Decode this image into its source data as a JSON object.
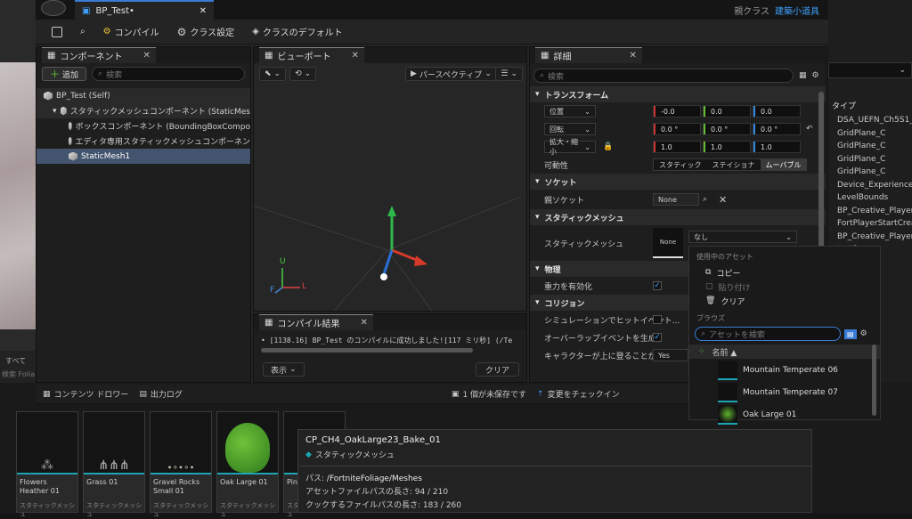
{
  "window": {
    "tab_title": "BP_Test•",
    "parent_label": "親クラス",
    "parent_value": "建築小道具"
  },
  "toolbar": {
    "compile": "コンパイル",
    "class_settings": "クラス設定",
    "class_defaults": "クラスのデフォルト"
  },
  "components": {
    "title": "コンポーネント",
    "add": "追加",
    "search_placeholder": "検索",
    "items": [
      "BP_Test (Self)",
      "スタティックメッシュコンポーネント (StaticMes",
      "ボックスコンポーネント (BoundingBoxCompo",
      "エディタ専用スタティックメッシュコンポーネン",
      "StaticMesh1"
    ]
  },
  "viewport": {
    "title": "ビューポート",
    "perspective": "パースペクティブ",
    "axis_x": "L",
    "axis_y": "F",
    "axis_z": "U"
  },
  "compile_results": {
    "title": "コンパイル結果",
    "message": "[1138.16] BP_Test のコンパイルに成功しました![117 ミリ秒] (/Te",
    "display": "表示",
    "clear": "クリア"
  },
  "details": {
    "title": "詳細",
    "search_placeholder": "検索",
    "transform": "トランスフォーム",
    "location": "位置",
    "rotation": "回転",
    "scale": "拡大・縮小",
    "loc": [
      "-0.0",
      "0.0",
      "0.0"
    ],
    "rot": [
      "0.0 °",
      "0.0 °",
      "0.0 °"
    ],
    "scl": [
      "1.0",
      "1.0",
      "1.0"
    ],
    "mobility": "可動性",
    "mobility_options": [
      "スタティック",
      "ステイショナ",
      "ムーバブル"
    ],
    "socket": "ソケット",
    "parent_socket": "親ソケット",
    "none": "None",
    "static_mesh_section": "スタティックメッシュ",
    "static_mesh": "スタティックメッシュ",
    "mesh_value": "なし",
    "physics": "物理",
    "enable_gravity": "重力を有効化",
    "collision": "コリジョン",
    "sim_hit": "シミュレーションでヒットイベント...",
    "overlap": "オーバーラップイベントを生成",
    "step_up": "キャラクターが上に登ることがで...",
    "step_up_value": "Yes"
  },
  "asset_popup": {
    "current_asset": "使用中のアセット",
    "copy": "コピー",
    "paste": "貼り付け",
    "clear": "クリア",
    "browse": "ブラウズ",
    "search_placeholder": "アセットを検索",
    "name_header": "名前 ▲",
    "assets": [
      "Mountain Temperate 06",
      "Mountain Temperate 07",
      "Oak Large 01"
    ]
  },
  "outliner_right": {
    "type_header": "タイプ",
    "rows": [
      "DSA_UEFN_Ch5S1_",
      "GridPlane_C",
      "GridPlane_C",
      "GridPlane_C",
      "GridPlane_C",
      "Device_ExperienceS",
      "LevelBounds",
      "BP_Creative_Player",
      "FortPlayerStartCrea",
      "BP_Creative_Player",
      "tartCrea",
      "ayers",
      "ionMiniM"
    ]
  },
  "bottom_bar": {
    "content_drawer": "コンテンツ ドロワー",
    "output_log": "出力ログ",
    "unsaved": "1 個が未保存です",
    "check_in": "変更をチェックイン",
    "all": "すべて",
    "search_folia": "検索 Folia"
  },
  "thumbnails": [
    {
      "name": "Flowers Heather 01",
      "type": "スタティックメッシュ"
    },
    {
      "name": "Grass 01",
      "type": "スタティックメッシュ"
    },
    {
      "name": "Gravel Rocks Small 01",
      "type": "スタティックメッシュ"
    },
    {
      "name": "Oak Large 01",
      "type": "スタティックメッシュ"
    },
    {
      "name": "Pin",
      "type": "スタティックメッシュ"
    }
  ],
  "tooltip": {
    "title": "CP_CH4_OakLarge23_Bake_01",
    "type": "スタティックメッシュ",
    "path_label": "パス:",
    "path_value": "/FortniteFoliage/Meshes",
    "asset_path_len": "アセットファイルパスの長さ: 94 / 210",
    "cook_path_len": "クックするファイルパスの長さ: 183 / 260"
  },
  "colors": {
    "accent": "#3a7bd5",
    "selection": "#43546e",
    "teal": "#1ca5b5"
  }
}
